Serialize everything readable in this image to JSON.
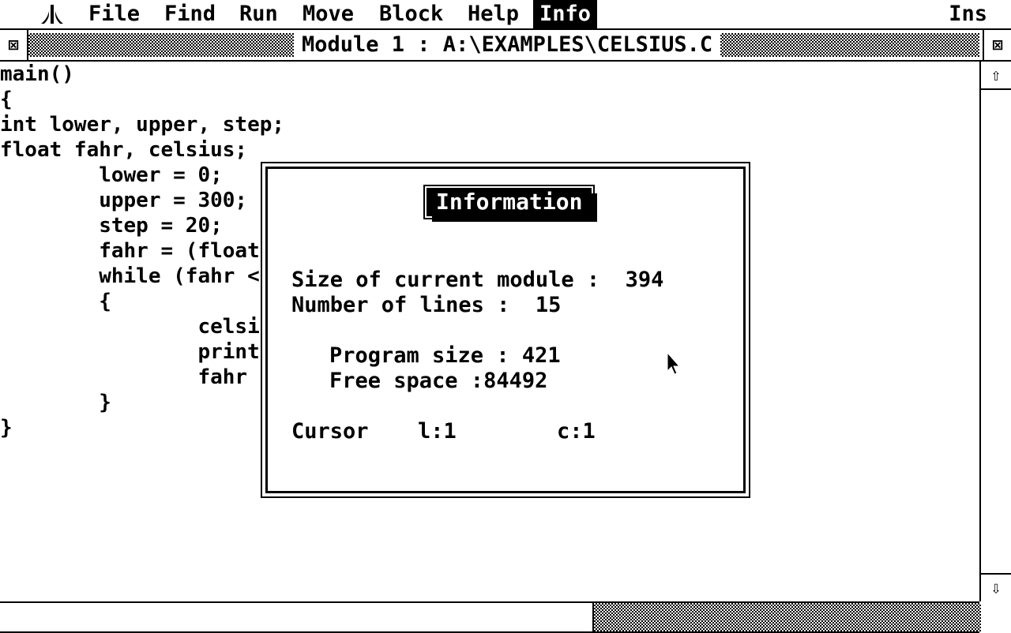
{
  "menubar": {
    "items": [
      "File",
      "Find",
      "Run",
      "Move",
      "Block",
      "Help",
      "Info"
    ],
    "active": "Info",
    "mode": "Ins"
  },
  "window": {
    "title": "Module 1 : A:\\EXAMPLES\\CELSIUS.C",
    "close_box": "⊠",
    "full_box": "⊠"
  },
  "scrollbar": {
    "up": "⇧",
    "down": "⇩"
  },
  "code": {
    "lines": [
      "main()",
      "{",
      "int lower, upper, step;",
      "float fahr, celsius;",
      "        lower = 0;",
      "        upper = 300;",
      "        step = 20;",
      "        fahr = (float",
      "        while (fahr <",
      "        {",
      "                celsi",
      "                print",
      "                fahr ",
      "        }",
      "}"
    ]
  },
  "dialog": {
    "title": "Information",
    "module_size_label": "Size of current module :  394",
    "lines_label": "Number of lines :  15",
    "program_size": "Program size : 421",
    "free_space": "Free space :84492",
    "cursor_label": "Cursor",
    "cursor_line": "l:1",
    "cursor_col": "c:1"
  }
}
